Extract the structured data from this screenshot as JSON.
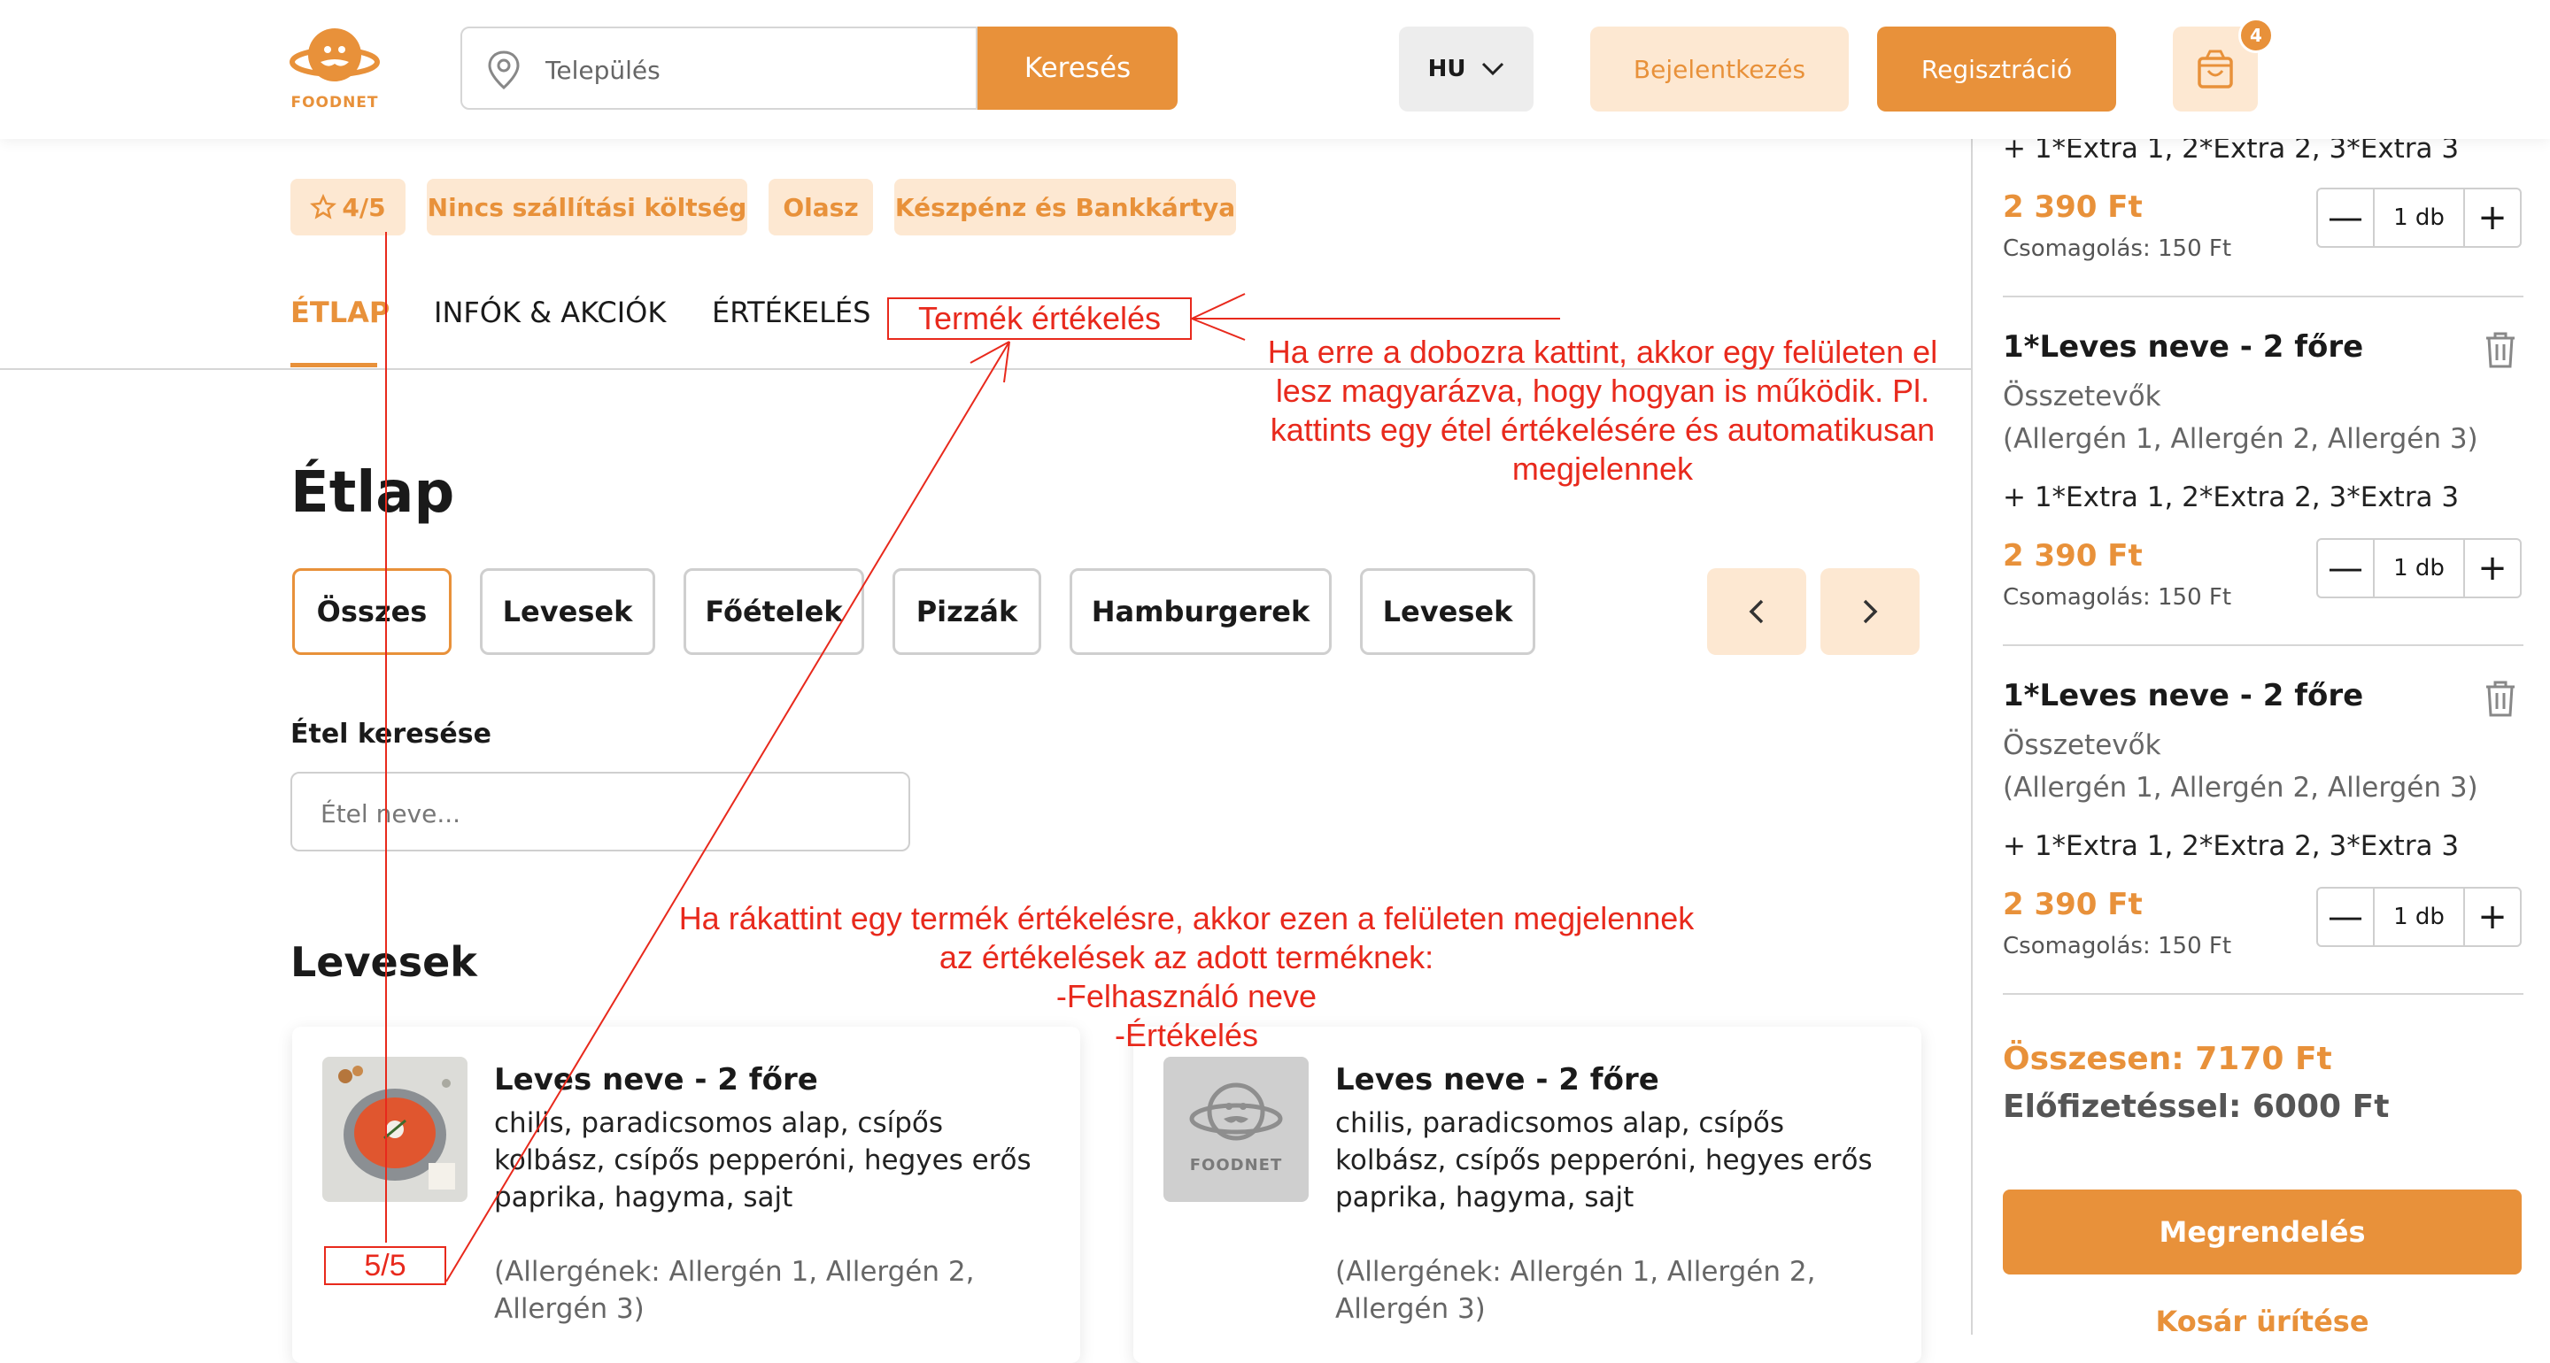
{
  "header": {
    "logo_text": "FOODNET",
    "search_placeholder": "Település",
    "search_button": "Keresés",
    "language": "HU",
    "login_button": "Bejelentkezés",
    "register_button": "Regisztráció",
    "cart_count": "4"
  },
  "tags": [
    "4/5",
    "Nincs szállítási költség",
    "Olasz",
    "Készpénz és Bankkártya"
  ],
  "tabs": [
    "ÉTLAP",
    "INFÓK & AKCIÓK",
    "ÉRTÉKELÉS"
  ],
  "menu": {
    "title": "Étlap",
    "categories": [
      "Összes",
      "Levesek",
      "Főételek",
      "Pizzák",
      "Hamburgerek",
      "Levesek"
    ],
    "food_search_label": "Étel keresése",
    "food_search_placeholder": "Étel neve...",
    "section_title": "Levesek",
    "cards": [
      {
        "title": "Leves neve - 2 főre",
        "desc": "chilis, paradicsomos alap, csípős kolbász, csípős pepperóni, hegyes erős paprika, hagyma, sajt",
        "allergens": "(Allergének: Allergén 1, Allergén 2, Allergén 3)"
      },
      {
        "title": "Leves neve - 2 főre",
        "desc": "chilis, paradicsomos alap, csípős kolbász, csípős pepperóni, hegyes erős paprika, hagyma, sajt",
        "allergens": "(Allergének: Allergén 1, Allergén 2, Allergén 3)",
        "placeholder_logo_text": "FOODNET"
      }
    ]
  },
  "cart": {
    "items": [
      {
        "extras": "+ 1*Extra 1, 2*Extra 2, 3*Extra 3",
        "price": "2 390 Ft",
        "packaging": "Csomagolás: 150 Ft",
        "qty": "1 db"
      },
      {
        "title": "1*Leves neve - 2 főre",
        "ingredients": "Összetevők",
        "allergens": "(Allergén 1, Allergén 2, Allergén 3)",
        "extras": "+ 1*Extra 1, 2*Extra 2, 3*Extra 3",
        "price": "2 390 Ft",
        "packaging": "Csomagolás: 150 Ft",
        "qty": "1 db"
      },
      {
        "title": "1*Leves neve - 2 főre",
        "ingredients": "Összetevők",
        "allergens": "(Allergén 1, Allergén 2, Allergén 3)",
        "extras": "+ 1*Extra 1, 2*Extra 2, 3*Extra 3",
        "price": "2 390 Ft",
        "packaging": "Csomagolás: 150 Ft",
        "qty": "1 db"
      }
    ],
    "total": "Összesen: 7170 Ft",
    "subscription_total": "Előfizetéssel: 6000 Ft",
    "order_button": "Megrendelés",
    "clear_button": "Kosár ürítése"
  },
  "annotations": {
    "rating_box": "Termék értékelés",
    "rating_box_note": "Ha erre a dobozra kattint, akkor egy felületen el lesz magyarázva, hogy hogyan is működik. Pl. kattints egy étel értékelésére és automatikusan megjelennek",
    "product_rating_note_1": "Ha rákattint egy termék értékelésre, akkor ezen a felületen megjelennek",
    "product_rating_note_2": "az értékelések az adott terméknek:",
    "product_rating_note_3": "-Felhasználó neve",
    "product_rating_note_4": "-Értékelés",
    "card_rating": "5/5"
  },
  "colors": {
    "accent": "#e8913a",
    "accent_light": "#fde8d2",
    "annotation": "#e8291c"
  }
}
